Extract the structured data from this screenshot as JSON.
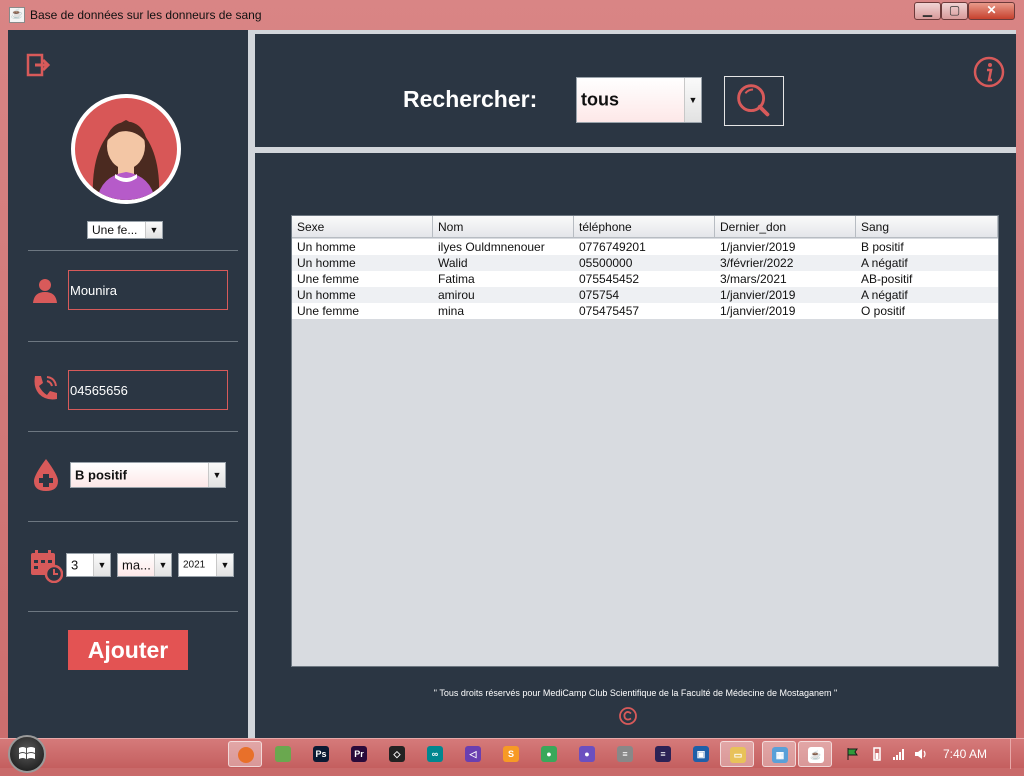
{
  "window": {
    "title": "Base de données sur les donneurs de sang",
    "app_icon": "java-icon"
  },
  "sidebar": {
    "gender_select": "Une fe...",
    "name_value": "Mounira",
    "phone_value": "04565656",
    "blood_select": "B positif",
    "date": {
      "day": "3",
      "month": "ma...",
      "year": "2021"
    },
    "add_button": "Ajouter"
  },
  "search": {
    "label": "Rechercher:",
    "filter_value": "tous"
  },
  "table": {
    "columns": [
      "Sexe",
      "Nom",
      "téléphone",
      "Dernier_don",
      "Sang"
    ],
    "rows": [
      [
        "Un homme",
        "ilyes Ouldmnenouer",
        "0776749201",
        "1/janvier/2019",
        "B positif"
      ],
      [
        "Un homme",
        "Walid",
        "05500000",
        "3/février/2022",
        "A négatif"
      ],
      [
        "Une femme",
        "Fatima",
        "075545452",
        "3/mars/2021",
        "AB-positif"
      ],
      [
        "Un homme",
        "amirou",
        "075754",
        "1/janvier/2019",
        "A négatif"
      ],
      [
        "Une femme",
        "mina",
        "075475457",
        "1/janvier/2019",
        "O positif"
      ]
    ]
  },
  "footer": {
    "copyright": "\" Tous droits réservés pour MediCamp Club Scientifique de la Faculté de Médecine de Mostaganem \""
  },
  "taskbar": {
    "clock": "7:40 AM",
    "apps": [
      "firefox-icon",
      "cloud-app-icon",
      "photoshop-icon",
      "premiere-icon",
      "unity-icon",
      "arduino-icon",
      "visual-studio-icon",
      "sublime-icon",
      "android-icon",
      "github-icon",
      "database-icon",
      "eclipse-icon",
      "virtualbox-icon",
      "file-explorer-icon",
      "windows-icon",
      "java-icon"
    ]
  },
  "colors": {
    "accent": "#e35353",
    "panel": "#2b3643",
    "title_bar": "#d98585"
  }
}
